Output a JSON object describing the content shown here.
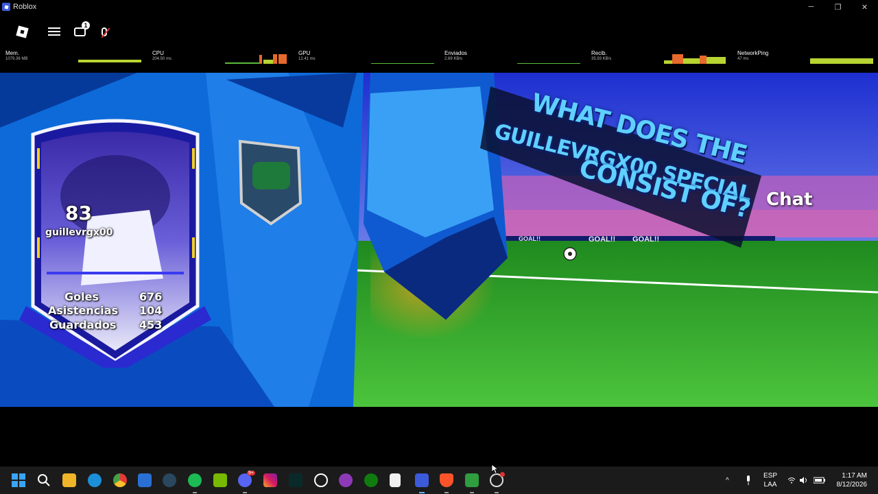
{
  "window": {
    "title": "Roblox",
    "minimize_glyph": "─",
    "maximize_glyph": "❐",
    "close_glyph": "✕"
  },
  "topbar": {
    "chat_badge": "1"
  },
  "stats": [
    {
      "name": "Mem.",
      "value": "1079.36 MB"
    },
    {
      "name": "CPU",
      "value": "204.50 ms"
    },
    {
      "name": "GPU",
      "value": "12.41 ms"
    },
    {
      "name": "Enviados",
      "value": "2.69 KB/s"
    },
    {
      "name": "Recib.",
      "value": "35.93 KB/s"
    },
    {
      "name": "NetworkPing",
      "value": "47 ms"
    }
  ],
  "player_card": {
    "rating": "83",
    "username": "guillevrgx00",
    "rows": [
      {
        "label": "Goles",
        "value": "676"
      },
      {
        "label": "Asistencias",
        "value": "104"
      },
      {
        "label": "Guardados",
        "value": "453"
      }
    ]
  },
  "banner": {
    "lines": [
      "WHAT DOES THE",
      "GUILLEVRGX00 SPECIAL",
      "CONSIST OF?"
    ]
  },
  "goal_signs": [
    "GOAL!!",
    "GOAL!!",
    "GOAL!!"
  ],
  "chat_label": "Chat",
  "taskbar": {
    "icons": [
      "windows-start-icon",
      "search-icon",
      "file-explorer-icon",
      "edge-icon",
      "chrome-icon",
      "store-icon",
      "steam-icon",
      "spotify-icon",
      "nvidia-icon",
      "discord-icon",
      "instagram-icon",
      "terminal-icon",
      "steelseries-icon",
      "app-icon",
      "xbox-icon",
      "notepad-icon",
      "roblox-icon",
      "brave-icon",
      "game-icon",
      "obs-icon"
    ],
    "discord_badge": "9+",
    "tray_chevron": "^",
    "language": "ESP",
    "layout": "LAA",
    "time": "1:17 AM",
    "date": "8/12/2026"
  }
}
